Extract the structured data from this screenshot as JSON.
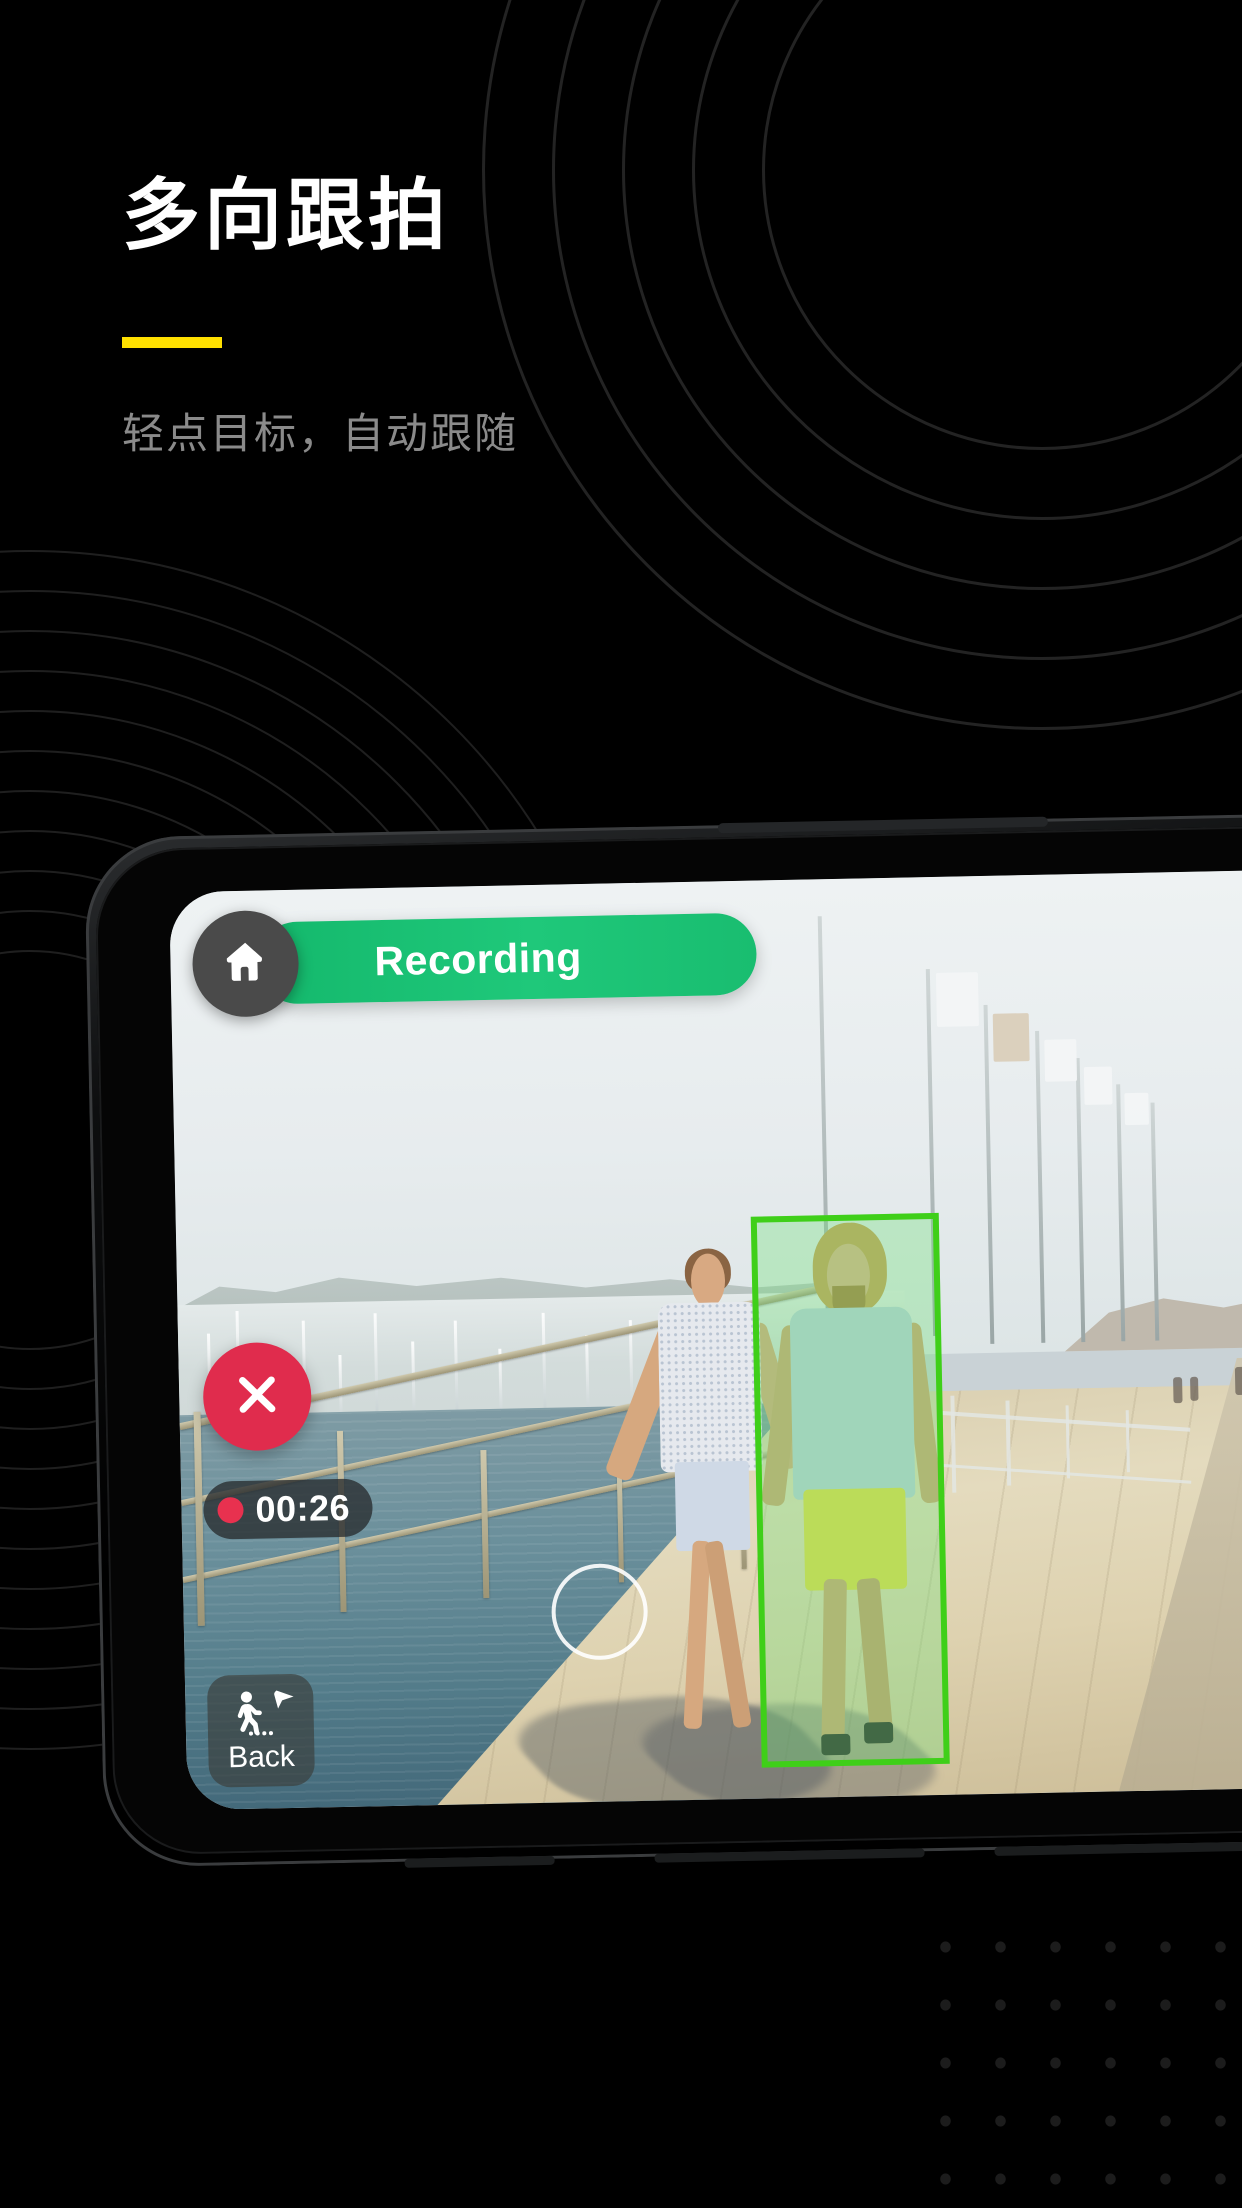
{
  "page": {
    "background_color": "#000000",
    "accent_color": "#ffe000"
  },
  "header": {
    "title": "多向跟拍",
    "subtitle": "轻点目标，自动跟随"
  },
  "phone": {
    "orientation": "landscape",
    "screen": {
      "recording_bar": {
        "status_label": "Recording",
        "pill_color": "#1fc87a",
        "home_icon": "home-icon"
      },
      "timer": {
        "value": "00:26",
        "indicator_color": "#e8314f",
        "indicator_icon": "record-dot-icon"
      },
      "stop_button": {
        "icon": "close-x-icon",
        "color": "#e02c4d"
      },
      "back_button": {
        "label": "Back",
        "icon": "walking-person-icon",
        "secondary_icon": "cursor-arrow-icon"
      },
      "tap_indicator": {
        "icon": "tap-circle-icon"
      },
      "tracking_box": {
        "border_color": "#3fcf19",
        "fill_color": "rgba(110,226,120,0.34)",
        "label": ""
      }
    }
  },
  "scene": {
    "description": "marina pier with couple walking",
    "subject_tracked": "man in blue shirt and yellow shorts",
    "subject_untracked": "woman in patterned shirt and denim shorts"
  }
}
